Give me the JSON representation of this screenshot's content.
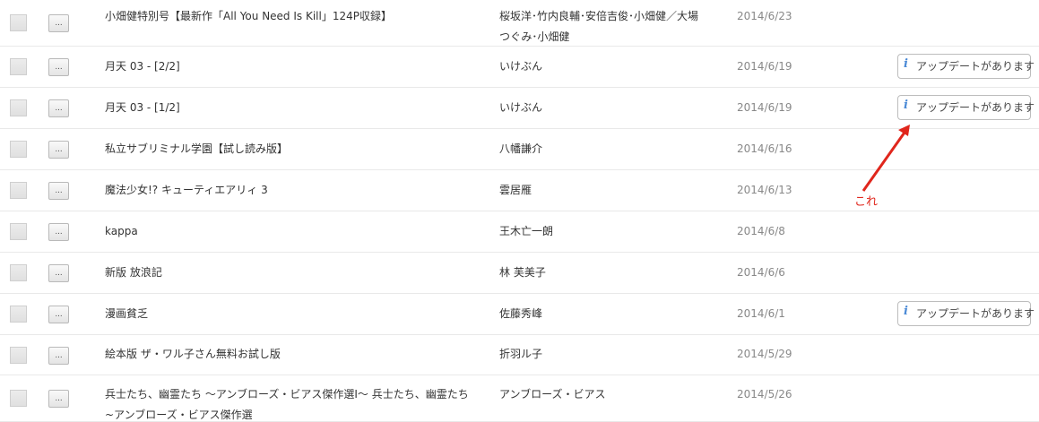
{
  "list": {
    "more_label": "...",
    "update_label": "アップデートがあります",
    "rows": [
      {
        "title_lines": [
          "小畑健特別号【最新作「All You Need Is Kill」124P収録】"
        ],
        "author_lines": [
          "桜坂洋･竹内良輔･安倍吉俊･小畑健／大場",
          "つぐみ･小畑健"
        ],
        "date": "2014/6/23",
        "has_update": false
      },
      {
        "title_lines": [
          "月天 03 - [2/2]"
        ],
        "author_lines": [
          "いけぶん"
        ],
        "date": "2014/6/19",
        "has_update": true
      },
      {
        "title_lines": [
          "月天 03 - [1/2]"
        ],
        "author_lines": [
          "いけぶん"
        ],
        "date": "2014/6/19",
        "has_update": true
      },
      {
        "title_lines": [
          "私立サブリミナル学園【試し読み版】"
        ],
        "author_lines": [
          "八幡謙介"
        ],
        "date": "2014/6/16",
        "has_update": false
      },
      {
        "title_lines": [
          "魔法少女!? キューティエアリィ 3"
        ],
        "author_lines": [
          "雲居雁"
        ],
        "date": "2014/6/13",
        "has_update": false
      },
      {
        "title_lines": [
          "kappa"
        ],
        "author_lines": [
          "王木亡一朗"
        ],
        "date": "2014/6/8",
        "has_update": false
      },
      {
        "title_lines": [
          "新版 放浪記"
        ],
        "author_lines": [
          "林 芙美子"
        ],
        "date": "2014/6/6",
        "has_update": false
      },
      {
        "title_lines": [
          "漫画貧乏"
        ],
        "author_lines": [
          "佐藤秀峰"
        ],
        "date": "2014/6/1",
        "has_update": true
      },
      {
        "title_lines": [
          "絵本版 ザ・ワル子さん無料お試し版"
        ],
        "author_lines": [
          "折羽ル子"
        ],
        "date": "2014/5/29",
        "has_update": false
      },
      {
        "title_lines": [
          "兵士たち、幽霊たち 〜アンブローズ・ビアス傑作選Ⅰ〜 兵士たち、幽霊たち",
          "~アンブローズ・ビアス傑作選"
        ],
        "author_lines": [
          "アンブローズ・ビアス"
        ],
        "date": "2014/5/26",
        "has_update": false
      }
    ]
  },
  "annotation": {
    "label": "これ",
    "color": "#e0261c"
  },
  "icons": {
    "info": "info-icon",
    "info_glyph": "i"
  }
}
